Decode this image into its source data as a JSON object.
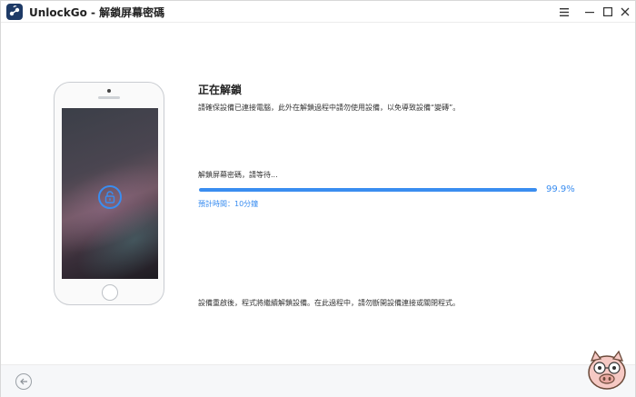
{
  "titlebar": {
    "title": "UnlockGo - 解鎖屏幕密碼",
    "menu_icon": "hamburger-icon",
    "minimize_icon": "minimize-icon",
    "maximize_icon": "maximize-icon",
    "close_icon": "close-icon"
  },
  "status": {
    "title": "正在解鎖",
    "description": "請確保設備已連接電腦，此外在解鎖過程中請勿使用設備，以免導致設備“變磚”。"
  },
  "progress": {
    "label": "解鎖屏幕密碼，請等待...",
    "percent_text": "99.9%",
    "value": 0.999,
    "eta": "預計時間：10分鐘"
  },
  "notice": "設備重啟後，程式將繼續解鎖設備。在此過程中，請勿斷開設備連接或關閉程式。",
  "colors": {
    "accent": "#3a8df0",
    "text": "#333333"
  },
  "icons": {
    "back": "back-arrow-icon",
    "lock": "unlock-icon",
    "mascot": "pig-mascot-icon"
  }
}
